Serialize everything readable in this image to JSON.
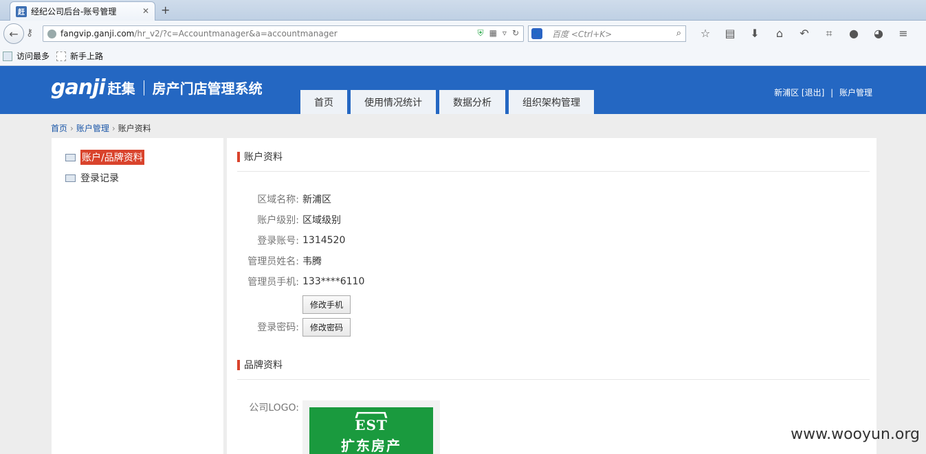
{
  "browser": {
    "tab_title": "经纪公司后台-账号管理",
    "tab_favicon": "赶",
    "url_domain": "fangvip.ganji.com",
    "url_path": "/hr_v2/?c=Accountmanager&a=accountmanager",
    "search_placeholder": "百度 <Ctrl+K>",
    "bookmarks": [
      "访问最多",
      "新手上路"
    ]
  },
  "header": {
    "logo_word": "ganji",
    "logo_cn": "赶集",
    "system_name": "房产门店管理系统",
    "nav": [
      "首页",
      "使用情况统计",
      "数据分析",
      "组织架构管理"
    ],
    "user_area": "新浦区",
    "logout": "[退出]",
    "divider": "|",
    "account_link": "账户管理"
  },
  "breadcrumb": [
    "首页",
    "账户管理",
    "账户资料"
  ],
  "sidebar": {
    "items": [
      "账户/品牌资料",
      "登录记录"
    ]
  },
  "account": {
    "section_title": "账户资料",
    "fields": [
      {
        "label": "区域名称:",
        "value": "新浦区"
      },
      {
        "label": "账户级别:",
        "value": "区域级别"
      },
      {
        "label": "登录账号:",
        "value": "1314520"
      },
      {
        "label": "管理员姓名:",
        "value": "韦腾"
      },
      {
        "label": "管理员手机:",
        "value": "133****6110"
      }
    ],
    "change_phone_button": "修改手机",
    "password_label": "登录密码:",
    "change_password_button": "修改密码"
  },
  "brand": {
    "section_title": "品牌资料",
    "logo_label": "公司LOGO:",
    "logo_mark": "EST",
    "logo_name": "扩东房产"
  },
  "watermark": "www.wooyun.org",
  "colors": {
    "header_blue": "#2467c2",
    "accent_red": "#d9432c",
    "logo_green": "#1a9a3e"
  }
}
